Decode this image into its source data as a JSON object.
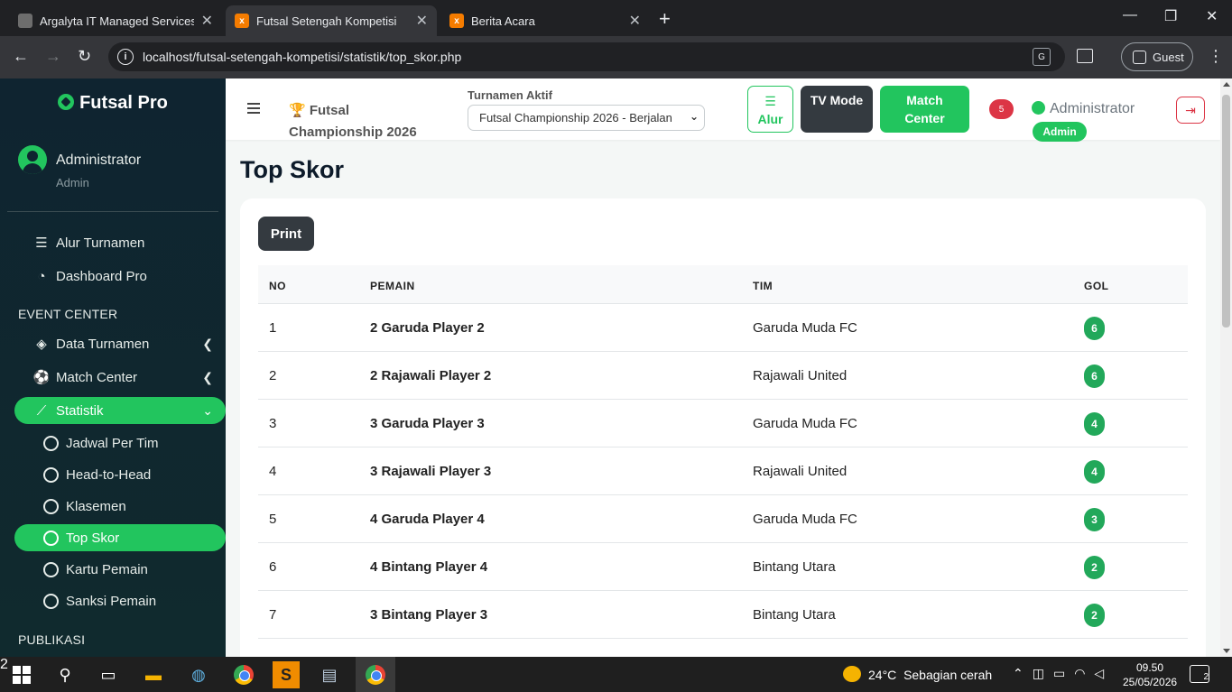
{
  "browser": {
    "tabs": [
      {
        "title": "Argalyta IT Managed Services &",
        "active": false
      },
      {
        "title": "Futsal Setengah Kompetisi",
        "active": true
      },
      {
        "title": "Berita Acara",
        "active": false
      }
    ],
    "url": "localhost/futsal-setengah-kompetisi/statistik/top_skor.php",
    "profile_label": "Guest"
  },
  "sidebar": {
    "brand": "Futsal Pro",
    "user_name": "Administrator",
    "user_role": "Admin",
    "items_top": [
      {
        "label": "Alur Turnamen",
        "icon": "list-check-icon"
      },
      {
        "label": "Dashboard Pro",
        "icon": "gauge-icon"
      }
    ],
    "section_event": "EVENT CENTER",
    "items_event": [
      {
        "label": "Data Turnamen",
        "icon": "layers-icon"
      },
      {
        "label": "Match Center",
        "icon": "ball-icon"
      },
      {
        "label": "Statistik",
        "icon": "chart-line-icon"
      }
    ],
    "sub_items": [
      {
        "label": "Jadwal Per Tim"
      },
      {
        "label": "Head-to-Head"
      },
      {
        "label": "Klasemen"
      },
      {
        "label": "Top Skor",
        "active": true
      },
      {
        "label": "Kartu Pemain"
      },
      {
        "label": "Sanksi Pemain"
      }
    ],
    "section_publikasi": "PUBLIKASI"
  },
  "topbar": {
    "title": "Futsal Championship 2026",
    "turnamen_label": "Turnamen Aktif",
    "turnamen_selected": "Futsal Championship 2026 - Berjalan",
    "btn_alur": "Alur",
    "btn_tv": "TV Mode",
    "btn_match": "Match Center",
    "notif_count": "5",
    "admin_name": "Administrator",
    "admin_badge": "Admin"
  },
  "page": {
    "title": "Top Skor",
    "print_label": "Print"
  },
  "table": {
    "headers": [
      "NO",
      "PEMAIN",
      "TIM",
      "GOL"
    ],
    "rows": [
      {
        "no": "1",
        "pemain": "2 Garuda Player 2",
        "tim": "Garuda Muda FC",
        "gol": "6"
      },
      {
        "no": "2",
        "pemain": "2 Rajawali Player 2",
        "tim": "Rajawali United",
        "gol": "6"
      },
      {
        "no": "3",
        "pemain": "3 Garuda Player 3",
        "tim": "Garuda Muda FC",
        "gol": "4"
      },
      {
        "no": "4",
        "pemain": "3 Rajawali Player 3",
        "tim": "Rajawali United",
        "gol": "4"
      },
      {
        "no": "5",
        "pemain": "4 Garuda Player 4",
        "tim": "Garuda Muda FC",
        "gol": "3"
      },
      {
        "no": "6",
        "pemain": "4 Bintang Player 4",
        "tim": "Bintang Utara",
        "gol": "2"
      },
      {
        "no": "7",
        "pemain": "3 Bintang Player 3",
        "tim": "Bintang Utara",
        "gol": "2"
      }
    ]
  },
  "taskbar": {
    "weather_temp": "24°C",
    "weather_desc": "Sebagian cerah",
    "weather_badge": "2",
    "time": "09.50",
    "date": "25/05/2026",
    "notif_count": "2"
  },
  "colors": {
    "accent": "#22c55e",
    "sidebar_bg": "#0f2430",
    "danger": "#dc3545",
    "dark_btn": "#343a40"
  }
}
